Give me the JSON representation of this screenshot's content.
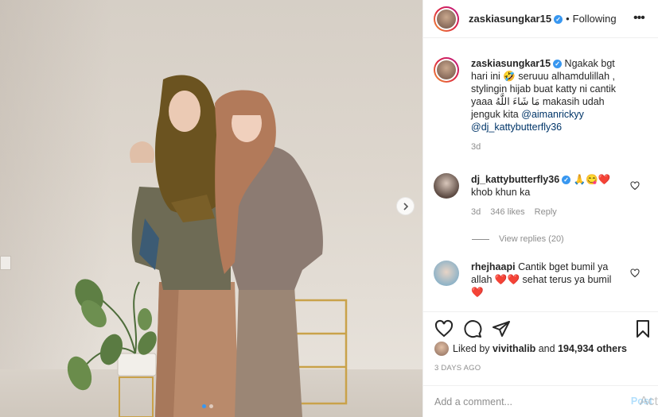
{
  "post": {
    "username": "zaskiasungkar15",
    "follow_sep": "•",
    "follow_status": "Following",
    "more_icon": "more-options-icon"
  },
  "caption": {
    "username": "zaskiasungkar15",
    "text_1": "Ngakak bgt hari ini",
    "emoji_1": "🤣",
    "text_2": "seruuu alhamdulillah , stylingin hijab buat katty ni cantik yaaa",
    "text_arabic": "مَا شَاءَ اللَّهُ",
    "text_3": "makasih udah jenguk kita",
    "mention_1": "@aimanrickyy",
    "mention_2": "@dj_kattybutterfly36",
    "time": "3d"
  },
  "comments": [
    {
      "username": "dj_kattybutterfly36",
      "emojis": "🙏😋❤️",
      "text": "khob khun ka",
      "time": "3d",
      "likes": "346 likes",
      "reply": "Reply",
      "view_replies": "View replies (20)"
    },
    {
      "username": "rhejhaapi",
      "text_1": "Cantik bget bumil ya allah",
      "emoji_1": "❤️❤️",
      "text_2": "sehat terus ya bumil",
      "emoji_2": "❤️"
    }
  ],
  "likes": {
    "prefix": "Liked by",
    "user": "vivithalib",
    "and": "and",
    "count": "194,934 others"
  },
  "date": "3 DAYS AGO",
  "add_comment": {
    "placeholder": "Add a comment...",
    "post_label": "Post"
  },
  "watermark": "Act",
  "colors": {
    "accent": "#3897f0",
    "mention": "#003569",
    "muted": "#8e8e8e",
    "heart": "#ed4956"
  }
}
